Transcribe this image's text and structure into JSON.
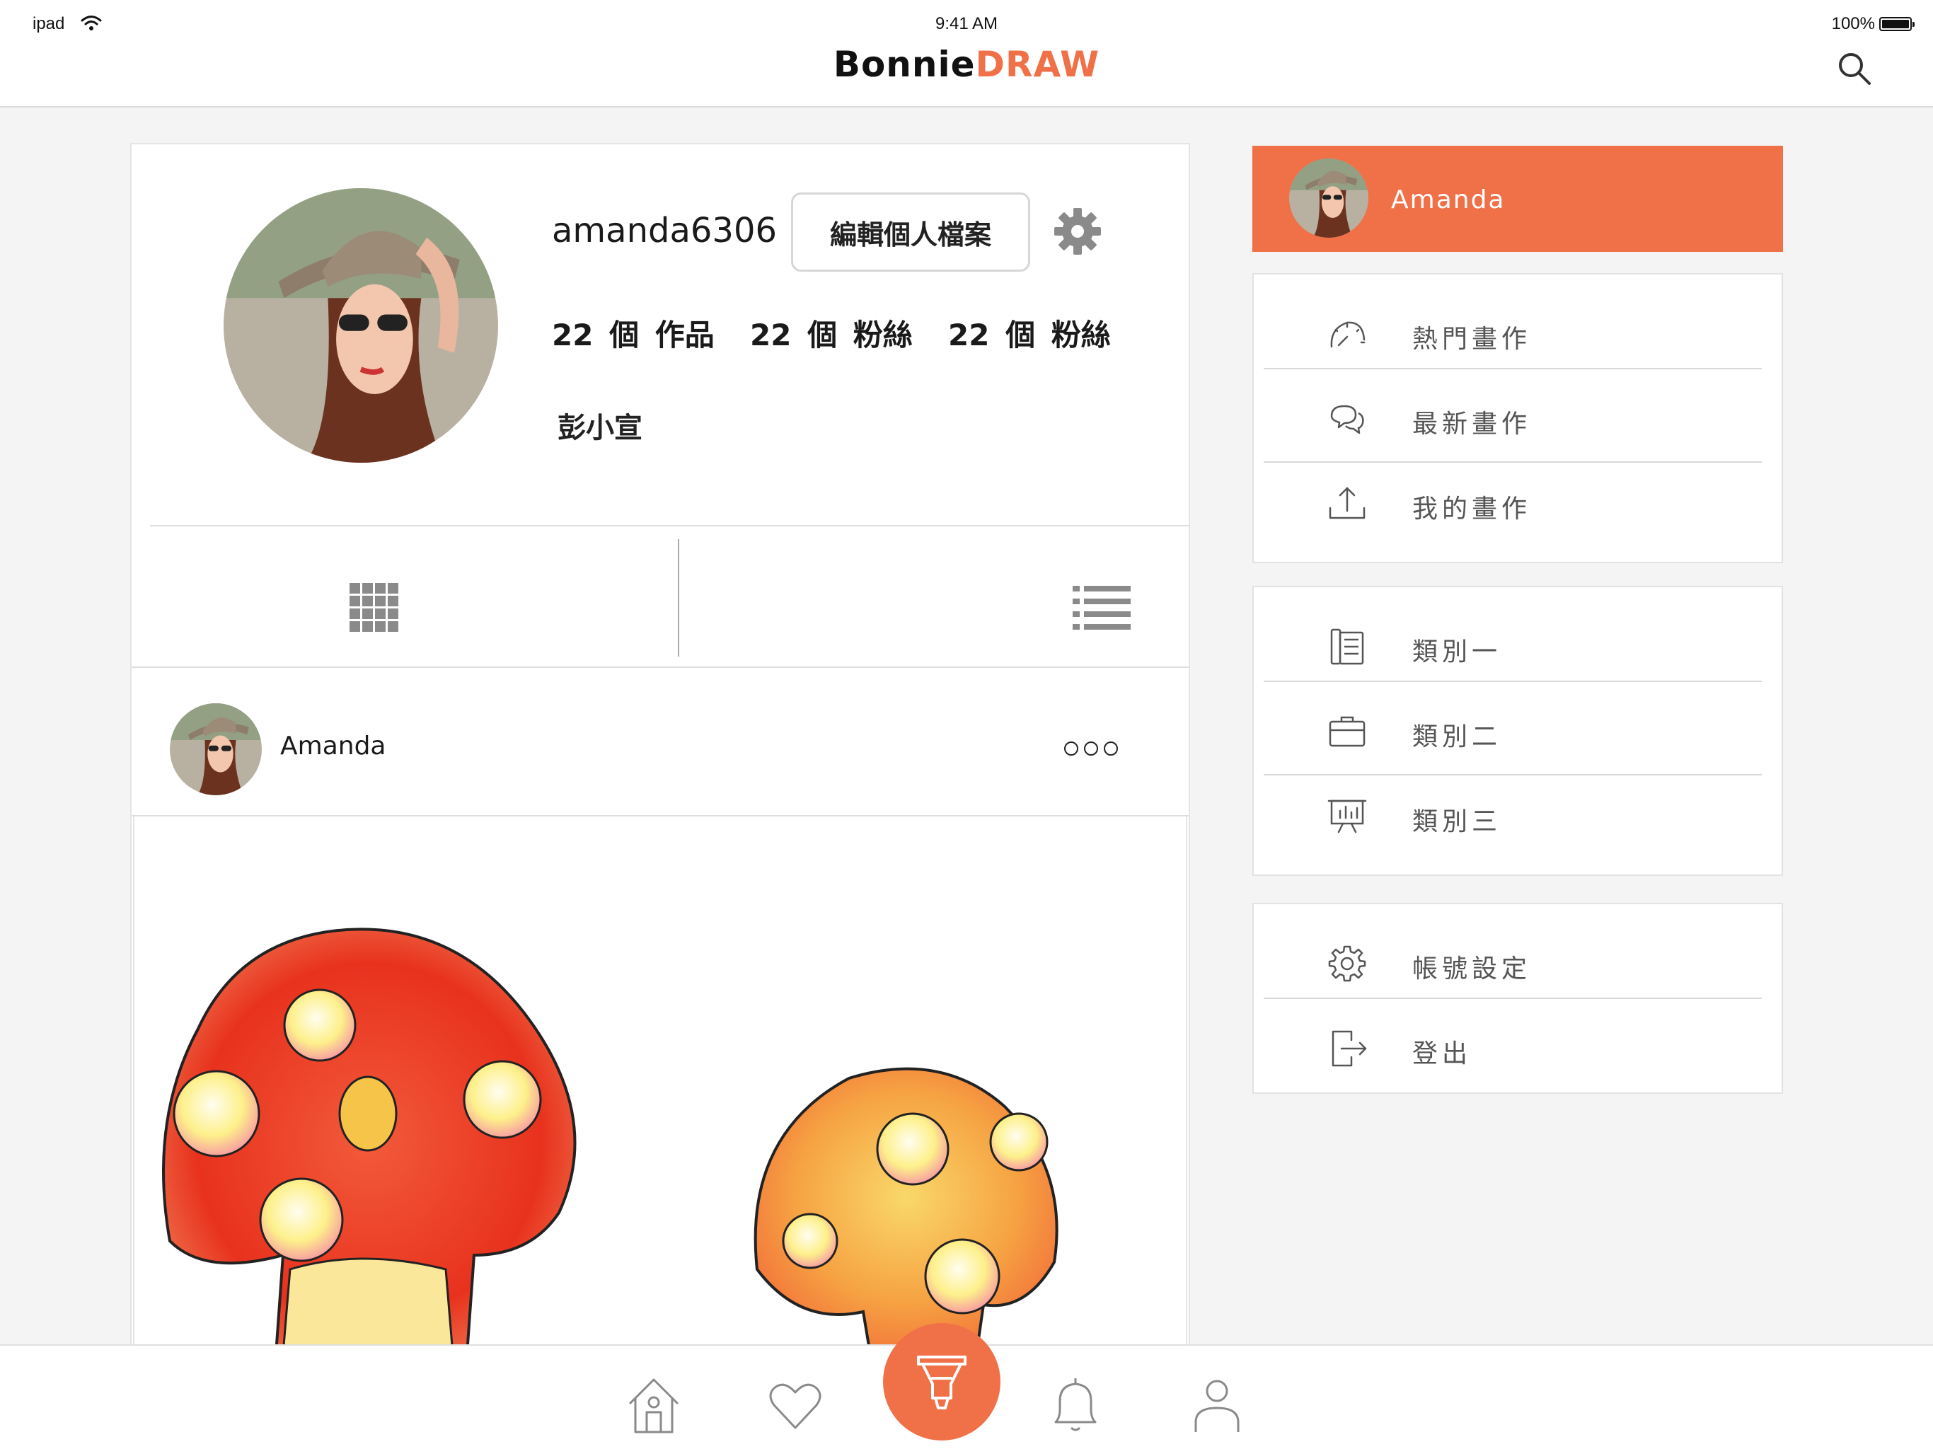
{
  "status_bar": {
    "carrier": "ipad",
    "time": "9:41 AM",
    "battery": "100%"
  },
  "header": {
    "logo_part1": "Bonnie",
    "logo_part2": "DRAW",
    "accent_color": "#f07048"
  },
  "profile": {
    "username": "amanda6306",
    "edit_button_label": "編輯個人檔案",
    "stats": [
      "22 個 作品",
      "22 個 粉絲",
      "22 個 粉絲"
    ],
    "display_name": "彭小宣"
  },
  "post": {
    "author": "Amanda"
  },
  "sidebar": {
    "user_name": "Amanda",
    "group1": [
      {
        "label": "熱門畫作",
        "icon": "speedometer-icon"
      },
      {
        "label": "最新畫作",
        "icon": "chat-bubbles-icon"
      },
      {
        "label": "我的畫作",
        "icon": "upload-icon"
      }
    ],
    "group2": [
      {
        "label": "類別一",
        "icon": "notebook-icon"
      },
      {
        "label": "類別二",
        "icon": "briefcase-icon"
      },
      {
        "label": "類別三",
        "icon": "presentation-icon"
      }
    ],
    "group3": [
      {
        "label": "帳號設定",
        "icon": "gear-icon"
      },
      {
        "label": "登出",
        "icon": "logout-icon"
      }
    ]
  },
  "tab_bar": {
    "tabs": [
      "home-icon",
      "heart-icon",
      "draw-icon",
      "bell-icon",
      "user-icon"
    ]
  }
}
